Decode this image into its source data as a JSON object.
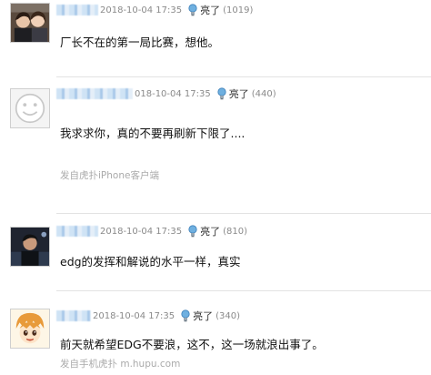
{
  "posts": [
    {
      "timestamp": "2018-10-04 17:35",
      "light_label": "亮了",
      "light_count": "(1019)",
      "content": "厂长不在的第一局比赛，想他。",
      "source": ""
    },
    {
      "timestamp": "018-10-04 17:35",
      "light_label": "亮了",
      "light_count": "(440)",
      "content": "我求求你，真的不要再刷新下限了....",
      "source": "发自虎扑iPhone客户端"
    },
    {
      "timestamp": "2018-10-04 17:35",
      "light_label": "亮了",
      "light_count": "(810)",
      "content": "edg的发挥和解说的水平一样，真实",
      "source": ""
    },
    {
      "timestamp": "2018-10-04 17:35",
      "light_label": "亮了",
      "light_count": "(340)",
      "content": "前天就希望EDG不要浪，这不，这一场就浪出事了。",
      "source": "发自手机虎扑 m.hupu.com"
    }
  ],
  "colors": {
    "meta_text": "#8a8a8a",
    "content_text": "#111111",
    "source_text": "#aaaaaa",
    "bulb": "#4a90c8"
  },
  "icons": {
    "light": "lightbulb-icon",
    "default_avatar": "smiley-face-icon"
  }
}
